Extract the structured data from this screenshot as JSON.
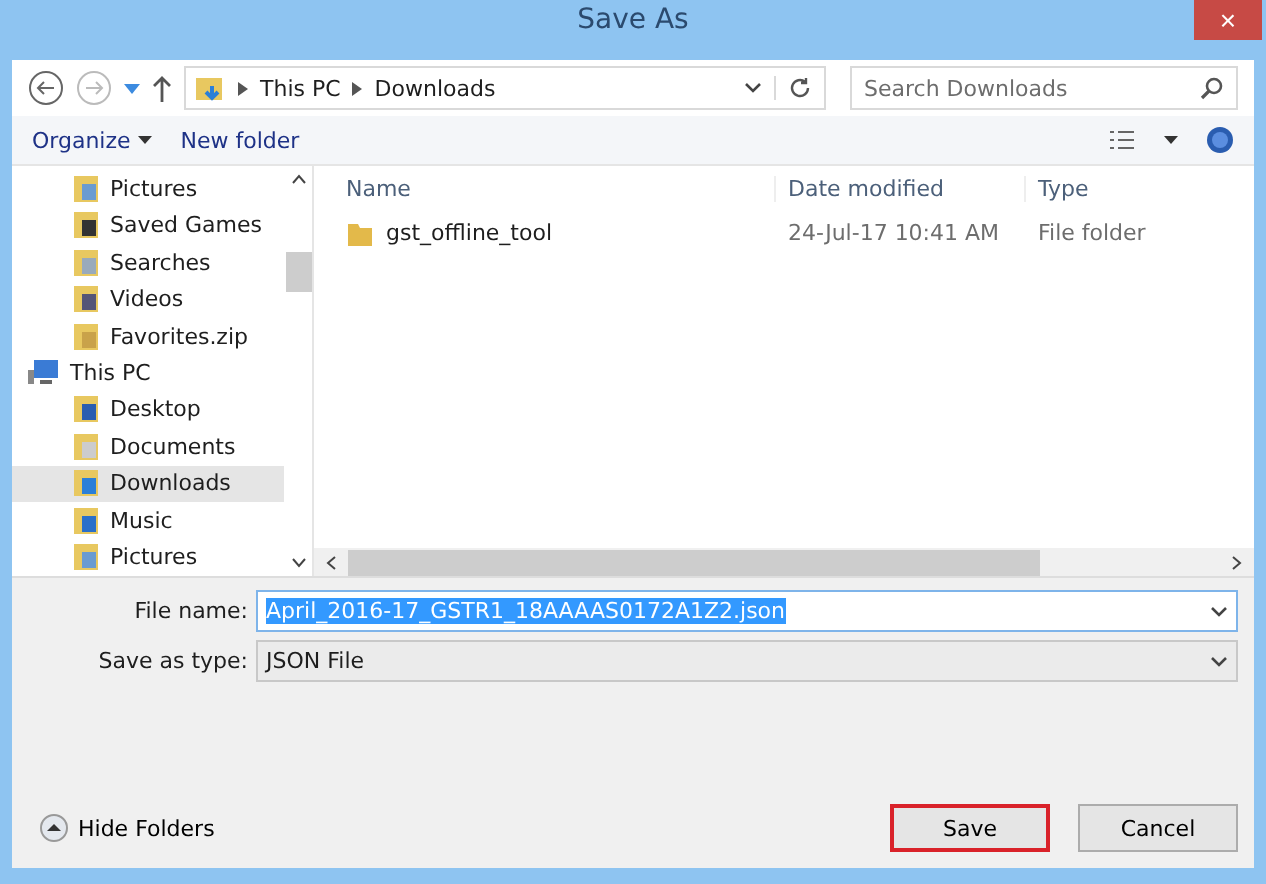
{
  "window": {
    "title": "Save As",
    "close": "×"
  },
  "address_bar": {
    "crumbs": [
      "This PC",
      "Downloads"
    ]
  },
  "search": {
    "placeholder": "Search Downloads"
  },
  "toolbar": {
    "organize": "Organize",
    "new_folder": "New folder"
  },
  "nav_items": [
    {
      "label": "Pictures",
      "kind": "pictures",
      "selected": false
    },
    {
      "label": "Saved Games",
      "kind": "games",
      "selected": false
    },
    {
      "label": "Searches",
      "kind": "search",
      "selected": false
    },
    {
      "label": "Videos",
      "kind": "videos",
      "selected": false
    },
    {
      "label": "Favorites.zip",
      "kind": "zip",
      "selected": false
    },
    {
      "label": "This PC",
      "kind": "pc",
      "selected": false,
      "children": [
        {
          "label": "Desktop",
          "kind": "desktop",
          "selected": false
        },
        {
          "label": "Documents",
          "kind": "documents",
          "selected": false
        },
        {
          "label": "Downloads",
          "kind": "downloads",
          "selected": true
        },
        {
          "label": "Music",
          "kind": "music",
          "selected": false
        },
        {
          "label": "Pictures",
          "kind": "pictures",
          "selected": false
        }
      ]
    }
  ],
  "table": {
    "columns": [
      "Name",
      "Date modified",
      "Type"
    ],
    "rows": [
      {
        "name": "gst_offline_tool",
        "date": "24-Jul-17 10:41 AM",
        "type": "File folder"
      }
    ]
  },
  "file_name": {
    "label": "File name:",
    "value": "April_2016-17_GSTR1_18AAAAS0172A1Z2.json",
    "selected": true
  },
  "save_type": {
    "label": "Save as type:",
    "value": "JSON File"
  },
  "hide_folders": "Hide Folders",
  "buttons": [
    {
      "label": "Save",
      "highlighted": true
    },
    {
      "label": "Cancel",
      "highlighted": false
    }
  ]
}
